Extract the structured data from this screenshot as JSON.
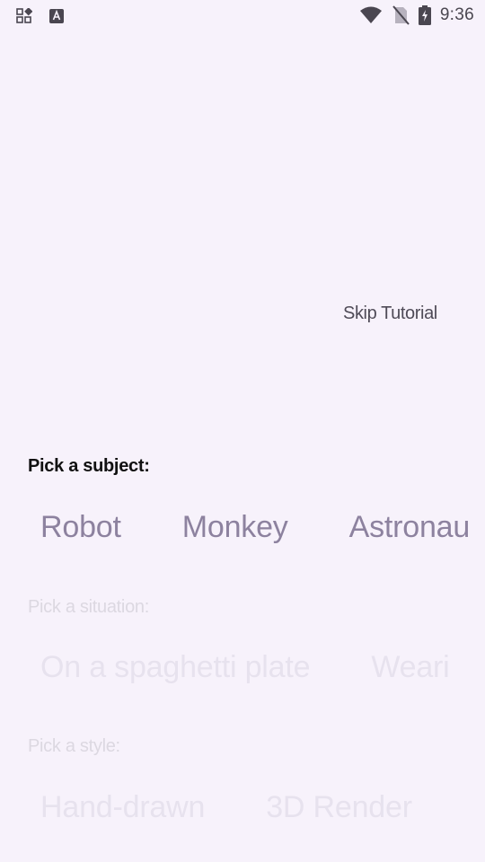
{
  "status_bar": {
    "time": "9:36",
    "left_icons": [
      "apps-grid-icon",
      "keyboard-a-icon"
    ],
    "right_icons": [
      "wifi-icon",
      "no-sim-icon",
      "battery-charging-icon"
    ]
  },
  "skip_tutorial": "Skip Tutorial",
  "subject": {
    "label": "Pick a subject:",
    "options": [
      "Robot",
      "Monkey",
      "Astronau"
    ]
  },
  "situation": {
    "label": "Pick a situation:",
    "options": [
      "On a spaghetti plate",
      "Weari"
    ]
  },
  "style": {
    "label": "Pick a style:",
    "options": [
      "Hand-drawn",
      "3D Render"
    ]
  },
  "colors": {
    "background": "#F7F2FB",
    "active_chip": "#8D829F",
    "inactive_chip": "#E7E2EE"
  }
}
